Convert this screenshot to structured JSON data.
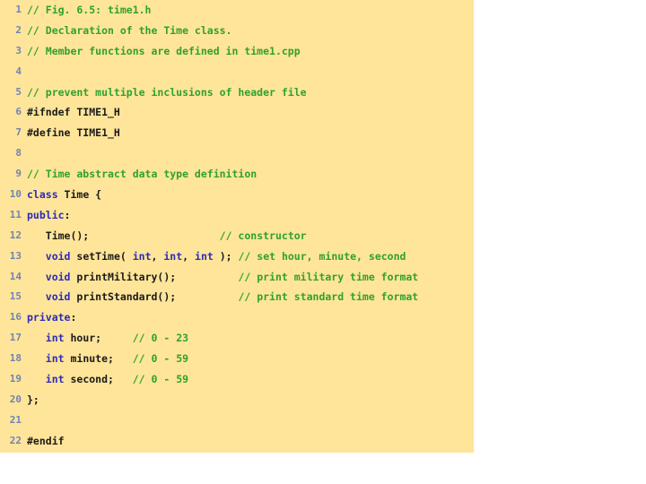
{
  "slide": {
    "name": "cpp-header-listing",
    "panel_bg": "#ffe599",
    "page_bg": "#ffffff",
    "colors": {
      "comment": "#2fa12f",
      "keyword": "#2b2bb8",
      "plain": "#1a1a1a",
      "linenumber": "#7183b5"
    }
  },
  "code": {
    "language": "cpp",
    "filename": "time1.h",
    "lines": [
      {
        "n": "1",
        "tokens": [
          {
            "t": "// Fig. 6.5: time1.h",
            "c": "com"
          }
        ]
      },
      {
        "n": "2",
        "tokens": [
          {
            "t": "// Declaration of the Time class.",
            "c": "com"
          }
        ]
      },
      {
        "n": "3",
        "tokens": [
          {
            "t": "// Member functions are defined in time1.cpp",
            "c": "com"
          }
        ]
      },
      {
        "n": "4",
        "tokens": []
      },
      {
        "n": "5",
        "tokens": [
          {
            "t": "// prevent multiple inclusions of header file",
            "c": "com"
          }
        ]
      },
      {
        "n": "6",
        "tokens": [
          {
            "t": "#ifndef TIME1_H",
            "c": "pre"
          }
        ]
      },
      {
        "n": "7",
        "tokens": [
          {
            "t": "#define TIME1_H",
            "c": "pre"
          }
        ]
      },
      {
        "n": "8",
        "tokens": []
      },
      {
        "n": "9",
        "tokens": [
          {
            "t": "// Time abstract data type definition",
            "c": "com"
          }
        ]
      },
      {
        "n": "10",
        "tokens": [
          {
            "t": "class",
            "c": "kw"
          },
          {
            "t": " Time {",
            "c": "plain"
          }
        ]
      },
      {
        "n": "11",
        "tokens": [
          {
            "t": "public",
            "c": "kw"
          },
          {
            "t": ":",
            "c": "plain"
          }
        ]
      },
      {
        "n": "12",
        "tokens": [
          {
            "t": "   Time();",
            "c": "plain"
          },
          {
            "t": "                     ",
            "c": "plain"
          },
          {
            "t": "// constructor",
            "c": "com"
          }
        ]
      },
      {
        "n": "13",
        "tokens": [
          {
            "t": "   ",
            "c": "plain"
          },
          {
            "t": "void",
            "c": "kw"
          },
          {
            "t": " setTime( ",
            "c": "plain"
          },
          {
            "t": "int",
            "c": "kw"
          },
          {
            "t": ", ",
            "c": "plain"
          },
          {
            "t": "int",
            "c": "kw"
          },
          {
            "t": ", ",
            "c": "plain"
          },
          {
            "t": "int",
            "c": "kw"
          },
          {
            "t": " ); ",
            "c": "plain"
          },
          {
            "t": "// set hour, minute, second",
            "c": "com"
          }
        ]
      },
      {
        "n": "14",
        "tokens": [
          {
            "t": "   ",
            "c": "plain"
          },
          {
            "t": "void",
            "c": "kw"
          },
          {
            "t": " printMilitary();",
            "c": "plain"
          },
          {
            "t": "          ",
            "c": "plain"
          },
          {
            "t": "// print military time format",
            "c": "com"
          }
        ]
      },
      {
        "n": "15",
        "tokens": [
          {
            "t": "   ",
            "c": "plain"
          },
          {
            "t": "void",
            "c": "kw"
          },
          {
            "t": " printStandard();",
            "c": "plain"
          },
          {
            "t": "          ",
            "c": "plain"
          },
          {
            "t": "// print standard time format",
            "c": "com"
          }
        ]
      },
      {
        "n": "16",
        "tokens": [
          {
            "t": "private",
            "c": "kw"
          },
          {
            "t": ":",
            "c": "plain"
          }
        ]
      },
      {
        "n": "17",
        "tokens": [
          {
            "t": "   ",
            "c": "plain"
          },
          {
            "t": "int",
            "c": "kw"
          },
          {
            "t": " hour;",
            "c": "plain"
          },
          {
            "t": "     ",
            "c": "plain"
          },
          {
            "t": "// 0 - 23",
            "c": "com"
          }
        ]
      },
      {
        "n": "18",
        "tokens": [
          {
            "t": "   ",
            "c": "plain"
          },
          {
            "t": "int",
            "c": "kw"
          },
          {
            "t": " minute;",
            "c": "plain"
          },
          {
            "t": "   ",
            "c": "plain"
          },
          {
            "t": "// 0 - 59",
            "c": "com"
          }
        ]
      },
      {
        "n": "19",
        "tokens": [
          {
            "t": "   ",
            "c": "plain"
          },
          {
            "t": "int",
            "c": "kw"
          },
          {
            "t": " second;",
            "c": "plain"
          },
          {
            "t": "   ",
            "c": "plain"
          },
          {
            "t": "// 0 - 59",
            "c": "com"
          }
        ]
      },
      {
        "n": "20",
        "tokens": [
          {
            "t": "};",
            "c": "plain"
          }
        ]
      },
      {
        "n": "21",
        "tokens": []
      },
      {
        "n": "22",
        "tokens": [
          {
            "t": "#endif",
            "c": "pre"
          }
        ]
      }
    ]
  }
}
